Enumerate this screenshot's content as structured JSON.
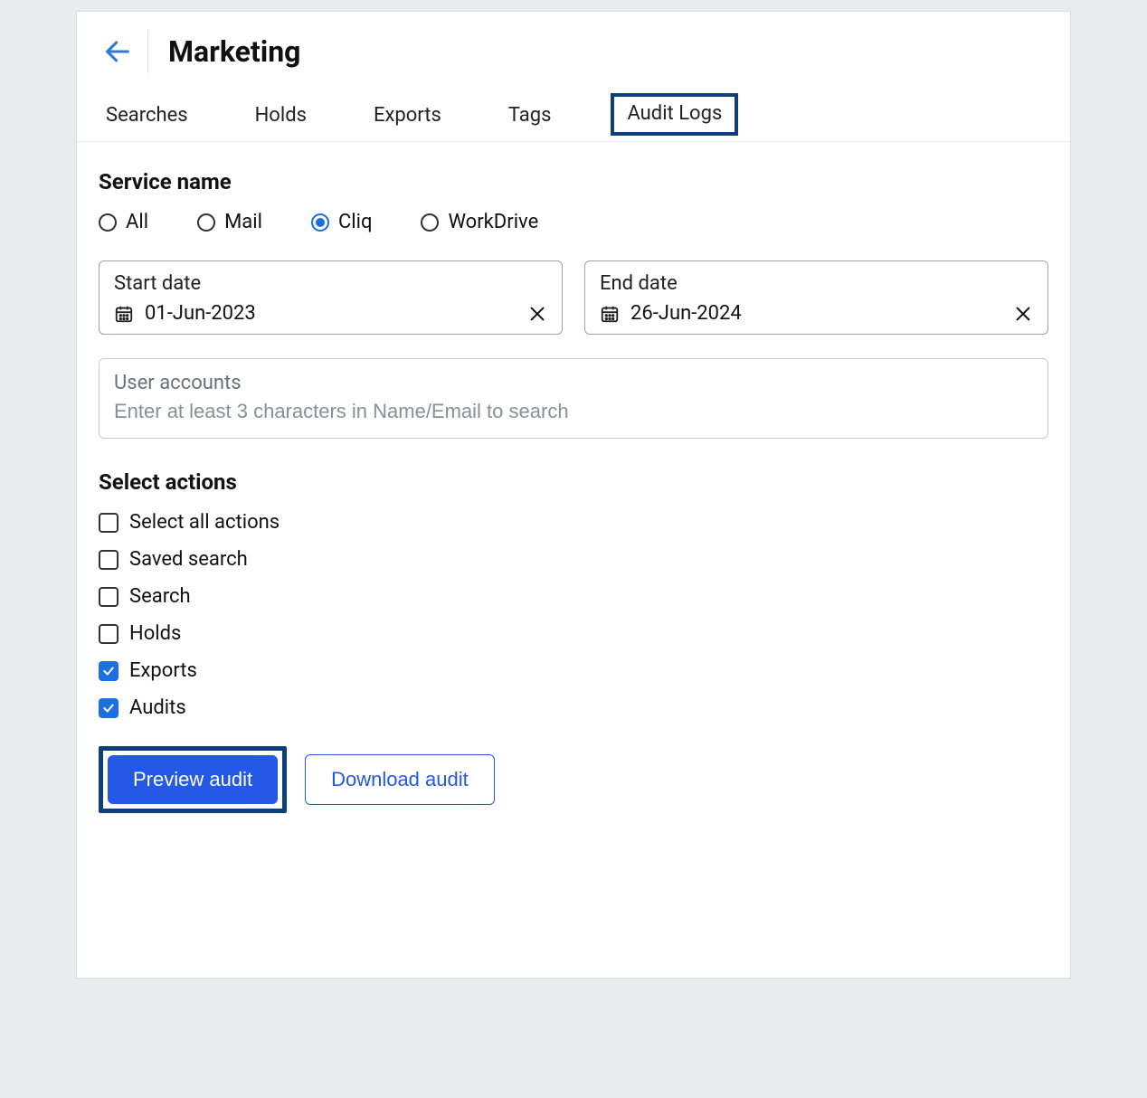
{
  "header": {
    "title": "Marketing"
  },
  "tabs": [
    {
      "label": "Searches",
      "active": false
    },
    {
      "label": "Holds",
      "active": false
    },
    {
      "label": "Exports",
      "active": false
    },
    {
      "label": "Tags",
      "active": false
    },
    {
      "label": "Audit Logs",
      "active": true
    }
  ],
  "service_name": {
    "title": "Service name",
    "options": [
      {
        "label": "All",
        "selected": false
      },
      {
        "label": "Mail",
        "selected": false
      },
      {
        "label": "Cliq",
        "selected": true
      },
      {
        "label": "WorkDrive",
        "selected": false
      }
    ]
  },
  "dates": {
    "start": {
      "label": "Start date",
      "value": "01-Jun-2023"
    },
    "end": {
      "label": "End date",
      "value": "26-Jun-2024"
    }
  },
  "user_accounts": {
    "label": "User accounts",
    "placeholder": "Enter at least 3 characters in Name/Email to search",
    "value": ""
  },
  "select_actions": {
    "title": "Select actions",
    "items": [
      {
        "label": "Select all actions",
        "checked": false
      },
      {
        "label": "Saved search",
        "checked": false
      },
      {
        "label": "Search",
        "checked": false
      },
      {
        "label": "Holds",
        "checked": false
      },
      {
        "label": "Exports",
        "checked": true
      },
      {
        "label": "Audits",
        "checked": true
      }
    ]
  },
  "buttons": {
    "preview": "Preview audit",
    "download": "Download audit"
  }
}
